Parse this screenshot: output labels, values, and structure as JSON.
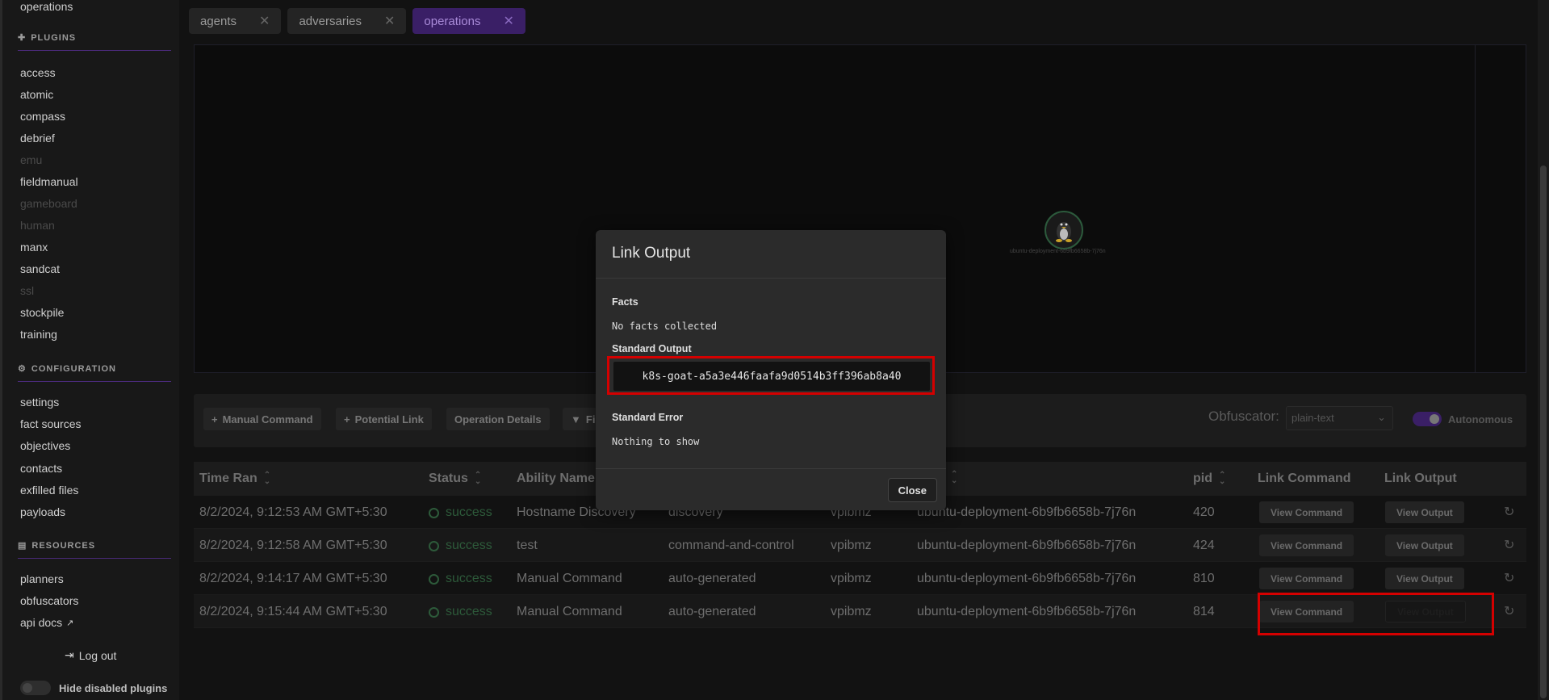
{
  "sidebar": {
    "top_item": "operations",
    "plugins_header": "PLUGINS",
    "plugins": [
      {
        "label": "access",
        "disabled": false
      },
      {
        "label": "atomic",
        "disabled": false
      },
      {
        "label": "compass",
        "disabled": false
      },
      {
        "label": "debrief",
        "disabled": false
      },
      {
        "label": "emu",
        "disabled": true
      },
      {
        "label": "fieldmanual",
        "disabled": false
      },
      {
        "label": "gameboard",
        "disabled": true
      },
      {
        "label": "human",
        "disabled": true
      },
      {
        "label": "manx",
        "disabled": false
      },
      {
        "label": "sandcat",
        "disabled": false
      },
      {
        "label": "ssl",
        "disabled": true
      },
      {
        "label": "stockpile",
        "disabled": false
      },
      {
        "label": "training",
        "disabled": false
      }
    ],
    "configuration_header": "CONFIGURATION",
    "configuration": [
      "settings",
      "fact sources",
      "objectives",
      "contacts",
      "exfilled files",
      "payloads"
    ],
    "resources_header": "RESOURCES",
    "resources": [
      "planners",
      "obfuscators",
      "api docs"
    ],
    "logout": "Log out",
    "hide_disabled": "Hide disabled plugins"
  },
  "tabs": [
    {
      "label": "agents",
      "active": false
    },
    {
      "label": "adversaries",
      "active": false
    },
    {
      "label": "operations",
      "active": true
    }
  ],
  "graph": {
    "node_label": "ubuntu-deployment-6b9fb6658b-7j76n"
  },
  "toolbar": {
    "manual_command": "Manual Command",
    "potential_link": "Potential Link",
    "operation_details": "Operation Details",
    "filter": "Fi",
    "obfuscator_label": "Obfuscator:",
    "obfuscator_value": "plain-text",
    "autonomous": "Autonomous"
  },
  "table": {
    "headers": {
      "time_ran": "Time Ran",
      "status": "Status",
      "ability_name": "Ability Name",
      "pid": "pid",
      "link_command": "Link Command",
      "link_output": "Link Output"
    },
    "view_command": "View Command",
    "view_output": "View Output",
    "rows": [
      {
        "time": "8/2/2024, 9:12:53 AM GMT+5:30",
        "status": "success",
        "ability": "Hostname Discovery",
        "tactic": "discovery",
        "agent": "vpibmz",
        "host": "ubuntu-deployment-6b9fb6658b-7j76n",
        "pid": "420"
      },
      {
        "time": "8/2/2024, 9:12:58 AM GMT+5:30",
        "status": "success",
        "ability": "test",
        "tactic": "command-and-control",
        "agent": "vpibmz",
        "host": "ubuntu-deployment-6b9fb6658b-7j76n",
        "pid": "424"
      },
      {
        "time": "8/2/2024, 9:14:17 AM GMT+5:30",
        "status": "success",
        "ability": "Manual Command",
        "tactic": "auto-generated",
        "agent": "vpibmz",
        "host": "ubuntu-deployment-6b9fb6658b-7j76n",
        "pid": "810"
      },
      {
        "time": "8/2/2024, 9:15:44 AM GMT+5:30",
        "status": "success",
        "ability": "Manual Command",
        "tactic": "auto-generated",
        "agent": "vpibmz",
        "host": "ubuntu-deployment-6b9fb6658b-7j76n",
        "pid": "814"
      }
    ]
  },
  "modal": {
    "title": "Link Output",
    "facts_label": "Facts",
    "facts_value": "No facts collected",
    "stdout_label": "Standard Output",
    "stdout_value": "k8s-goat-a5a3e446faafa9d0514b3ff396ab8a40",
    "stderr_label": "Standard Error",
    "stderr_value": "Nothing to show",
    "close": "Close"
  },
  "colors": {
    "accent": "#3a1f66",
    "highlight": "#d40000",
    "success": "#2d5a3a"
  }
}
